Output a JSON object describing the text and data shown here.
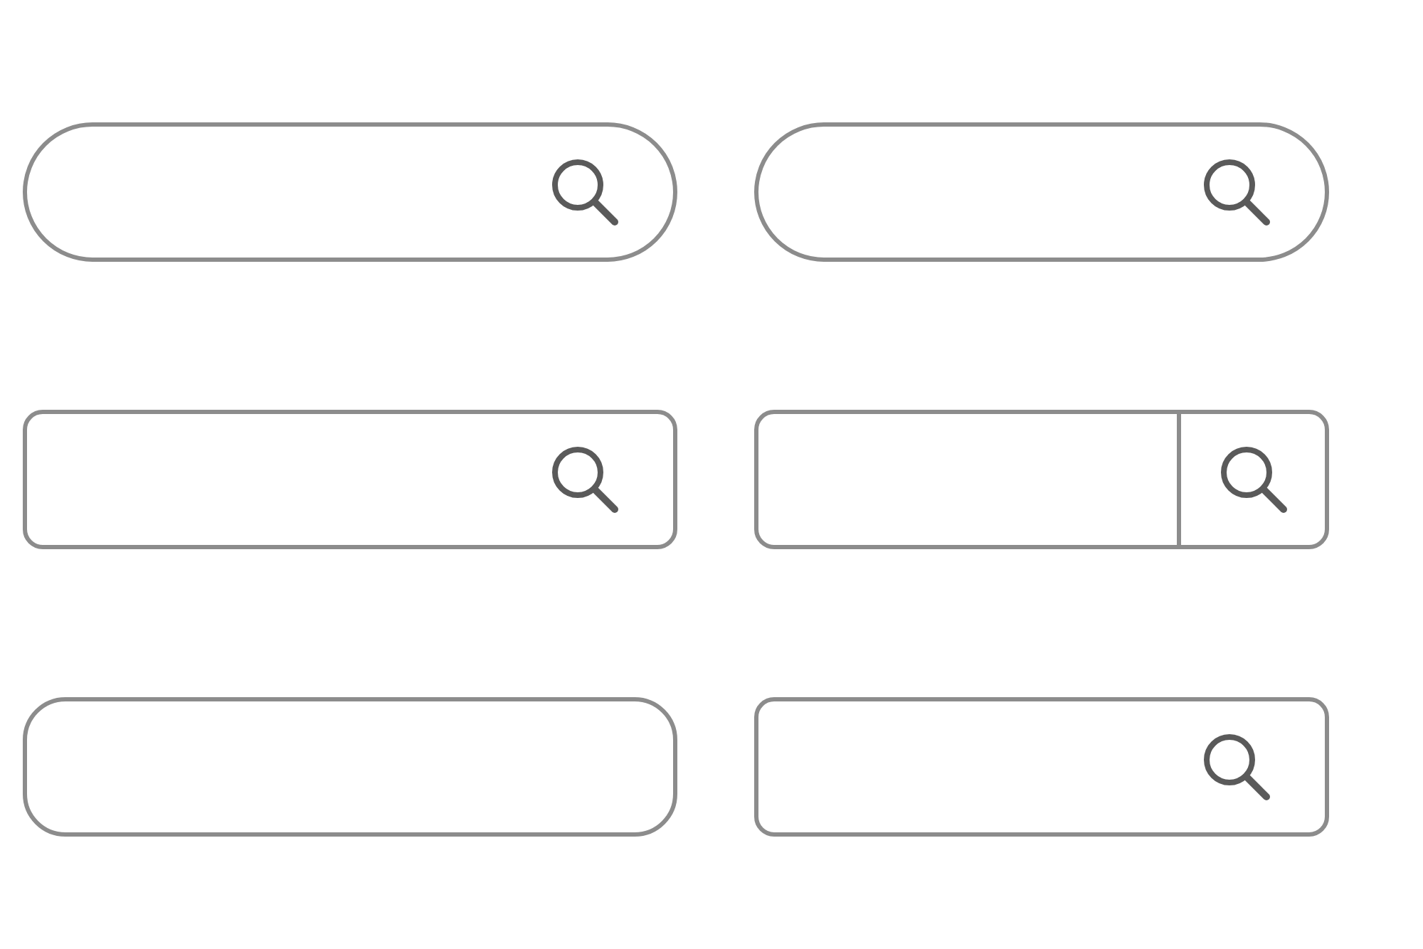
{
  "search_bars": [
    {
      "kind": "pill",
      "search_icon": true
    },
    {
      "kind": "pill",
      "search_icon": true
    },
    {
      "kind": "rounded",
      "search_icon": true
    },
    {
      "kind": "segmented",
      "search_icon": true
    },
    {
      "kind": "soft",
      "search_icon": false
    },
    {
      "kind": "rounded",
      "search_icon": true
    }
  ]
}
